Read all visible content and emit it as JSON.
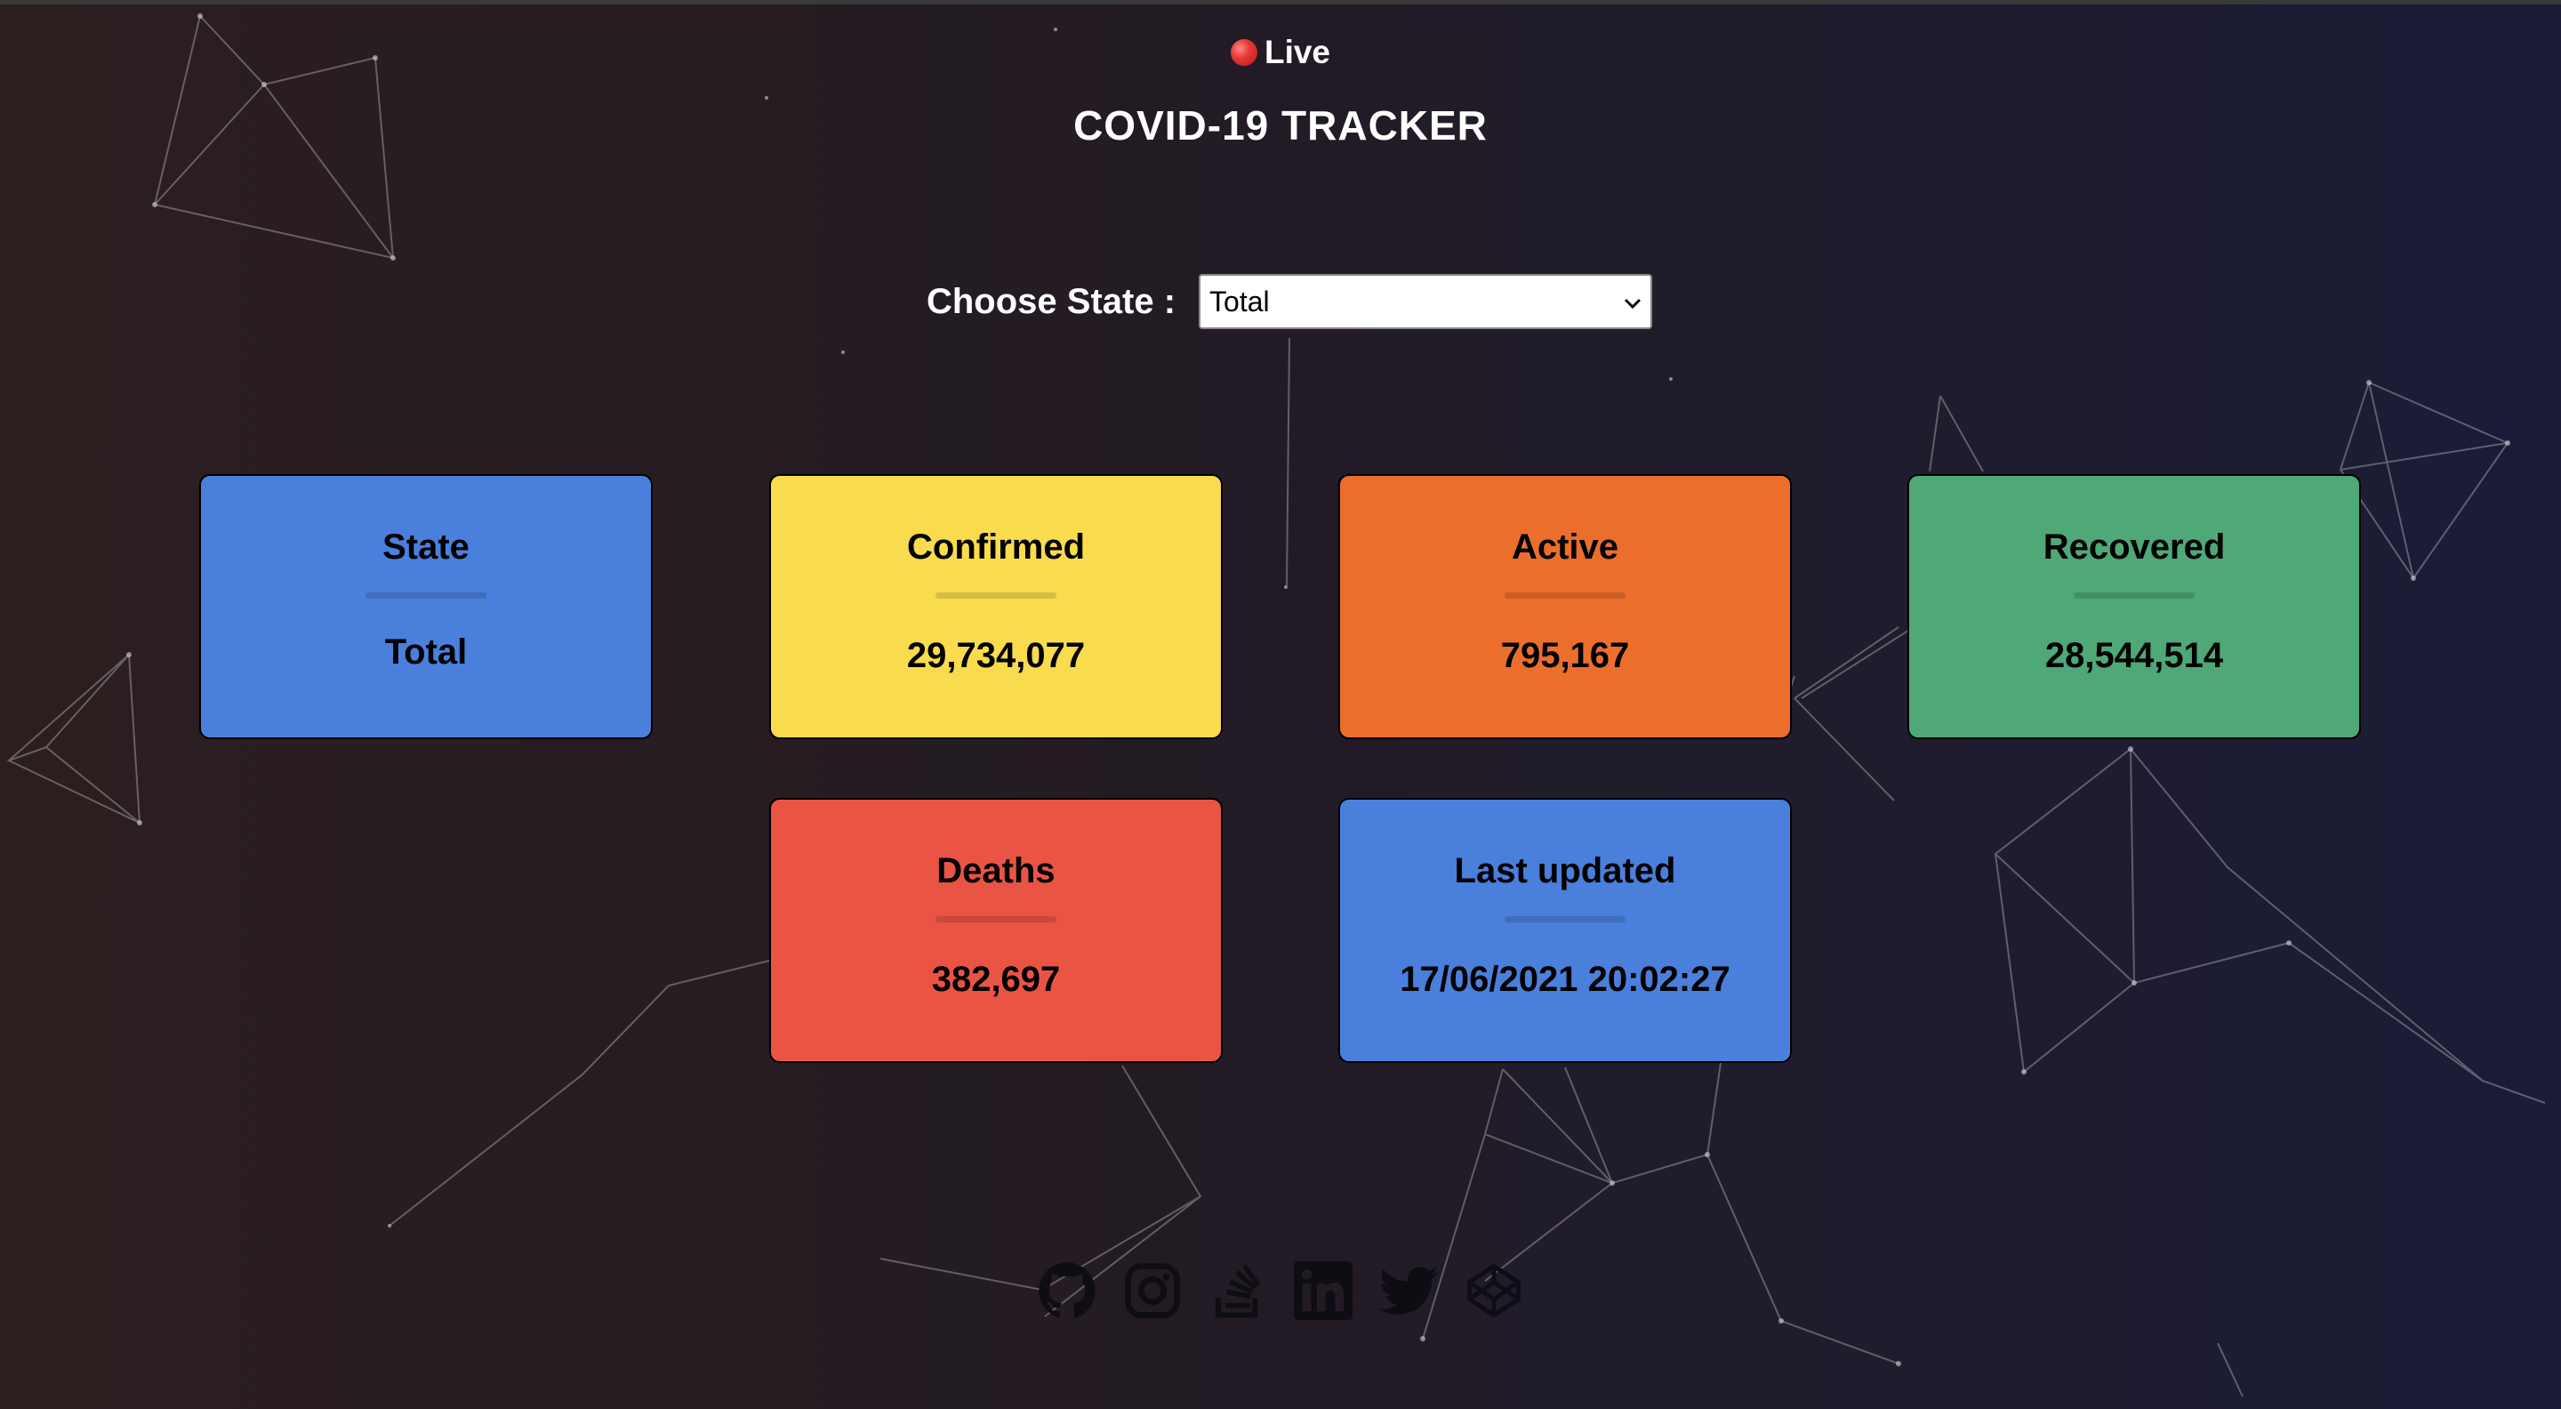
{
  "header": {
    "live_label": "Live",
    "title": "COVID-19 TRACKER"
  },
  "state_select": {
    "label": "Choose State :",
    "selected": "Total"
  },
  "cards": {
    "state": {
      "title": "State",
      "value": "Total",
      "color": "#4a7fdc"
    },
    "confirmed": {
      "title": "Confirmed",
      "value": "29,734,077",
      "color": "#f9db4e"
    },
    "active": {
      "title": "Active",
      "value": "795,167",
      "color": "#ec6e2c"
    },
    "recovered": {
      "title": "Recovered",
      "value": "28,544,514",
      "color": "#4fa878"
    },
    "deaths": {
      "title": "Deaths",
      "value": "382,697",
      "color": "#e95444"
    },
    "last_updated": {
      "title": "Last updated",
      "value": "17/06/2021 20:02:27",
      "color": "#4a7fdc"
    }
  },
  "social_links": [
    {
      "icon": "github-icon"
    },
    {
      "icon": "instagram-icon"
    },
    {
      "icon": "stackoverflow-icon"
    },
    {
      "icon": "linkedin-icon"
    },
    {
      "icon": "twitter-icon"
    },
    {
      "icon": "codepen-icon"
    }
  ]
}
